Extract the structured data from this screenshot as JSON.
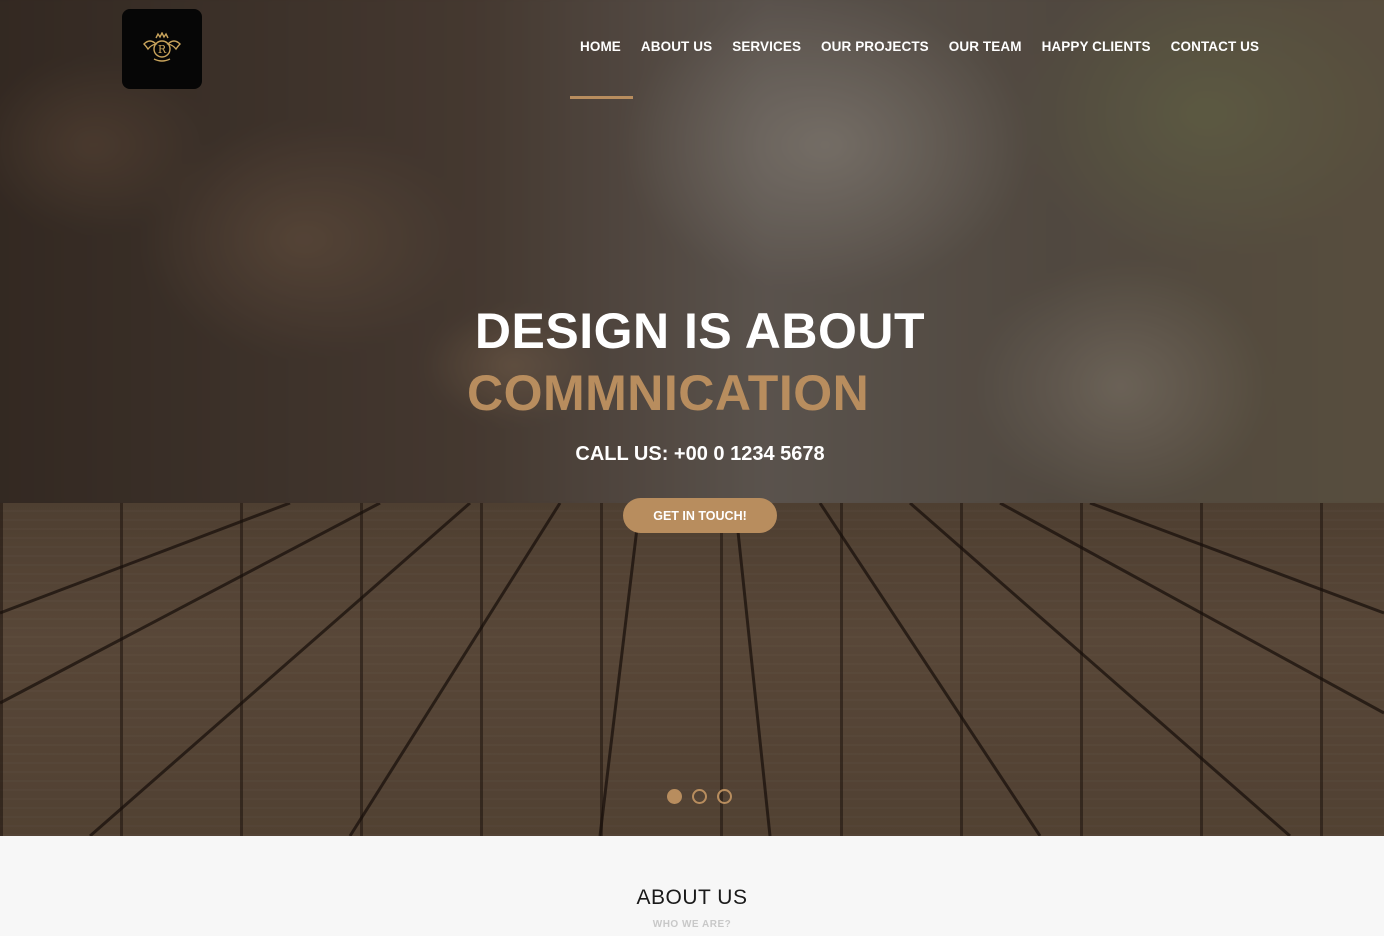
{
  "nav": {
    "items": [
      {
        "label": "HOME"
      },
      {
        "label": "ABOUT US"
      },
      {
        "label": "SERVICES"
      },
      {
        "label": "OUR PROJECTS"
      },
      {
        "label": "OUR TEAM"
      },
      {
        "label": "HAPPY CLIENTS"
      },
      {
        "label": "CONTACT US"
      }
    ],
    "active": "HOME"
  },
  "logo": {
    "icon": "crest-logo-icon",
    "letter": "R"
  },
  "hero": {
    "title_line1": "DESIGN IS ABOUT",
    "title_line2": "COMMNICATION",
    "call": "CALL US: +00 0 1234 5678",
    "cta_label": "GET IN TOUCH!",
    "slides": 3,
    "active_slide": 1
  },
  "about": {
    "title": "ABOUT US",
    "subtitle": "WHO WE ARE?"
  },
  "colors": {
    "accent": "#b88d5e",
    "text_light": "#ffffff",
    "text_dark": "#1a1a1a",
    "muted": "#c8c8c8"
  }
}
